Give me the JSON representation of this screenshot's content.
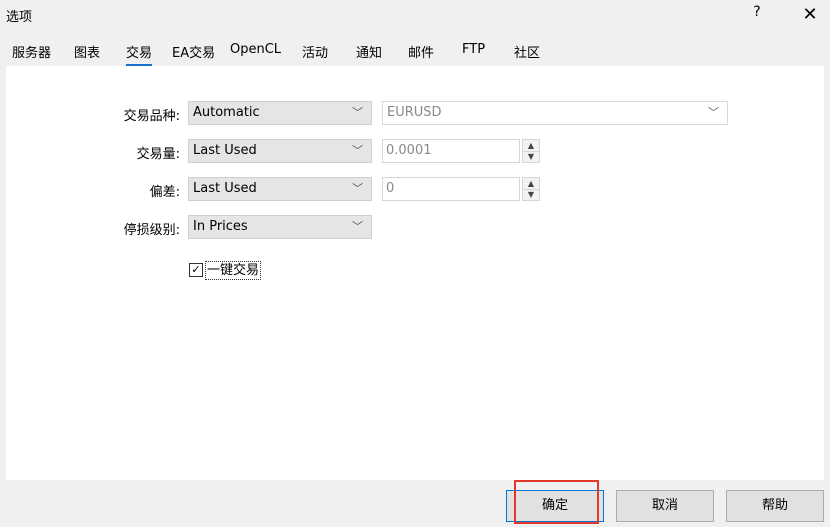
{
  "window": {
    "title": "选项",
    "help_label": "?",
    "close_label": "✕"
  },
  "tabs": [
    {
      "label": "服务器",
      "active": false
    },
    {
      "label": "图表",
      "active": false
    },
    {
      "label": "交易",
      "active": true
    },
    {
      "label": "EA交易",
      "active": false
    },
    {
      "label": "OpenCL",
      "active": false
    },
    {
      "label": "活动",
      "active": false
    },
    {
      "label": "通知",
      "active": false
    },
    {
      "label": "邮件",
      "active": false
    },
    {
      "label": "FTP",
      "active": false
    },
    {
      "label": "社区",
      "active": false
    }
  ],
  "form": {
    "symbol": {
      "label": "交易品种:",
      "mode": "Automatic",
      "value": "EURUSD"
    },
    "volume": {
      "label": "交易量:",
      "mode": "Last Used",
      "value": "0.0001"
    },
    "deviation": {
      "label": "偏差:",
      "mode": "Last Used",
      "value": "0"
    },
    "stop_level": {
      "label": "停损级别:",
      "mode": "In Prices"
    },
    "one_click": {
      "label": "一键交易",
      "checked": true,
      "check_glyph": "✓"
    }
  },
  "buttons": {
    "ok": "确定",
    "cancel": "取消",
    "help": "帮助"
  },
  "icons": {
    "chevron": "﹀",
    "spin_up": "▲",
    "spin_down": "▼"
  }
}
